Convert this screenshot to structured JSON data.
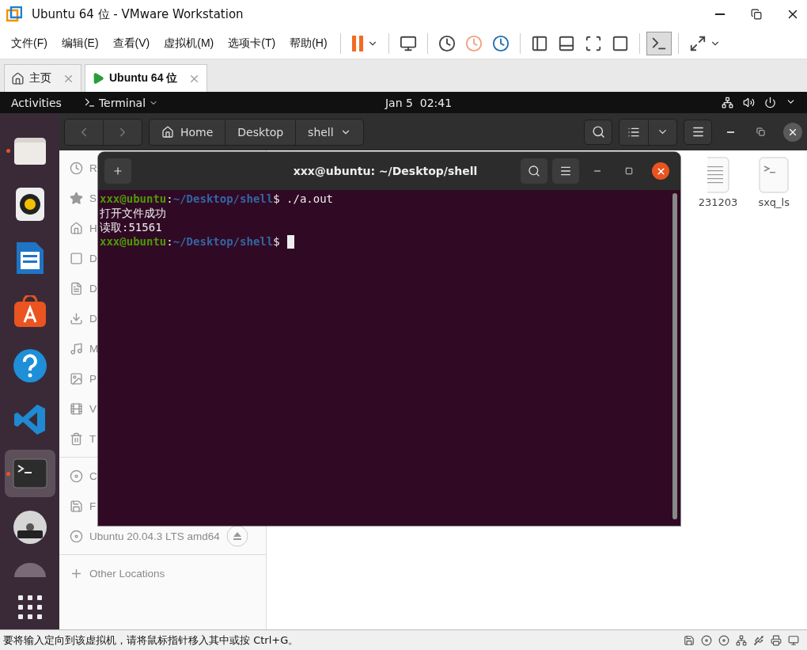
{
  "window": {
    "title": "Ubuntu 64 位 - VMware Workstation"
  },
  "menu": [
    {
      "label": "文件(F)"
    },
    {
      "label": "编辑(E)"
    },
    {
      "label": "查看(V)"
    },
    {
      "label": "虚拟机(M)"
    },
    {
      "label": "选项卡(T)"
    },
    {
      "label": "帮助(H)"
    }
  ],
  "toolbar": [
    {
      "kind": "pause",
      "selected": false
    },
    {
      "kind": "send-keys",
      "selected": false
    },
    {
      "kind": "snapshot",
      "selected": false
    },
    {
      "kind": "revert",
      "selected": false
    },
    {
      "kind": "snapshot-manager",
      "selected": false
    },
    {
      "kind": "library",
      "selected": false
    },
    {
      "kind": "thumbnail",
      "selected": false
    },
    {
      "kind": "full-screen",
      "selected": false
    },
    {
      "kind": "unity",
      "selected": false
    },
    {
      "kind": "console",
      "selected": true
    },
    {
      "kind": "stretch",
      "selected": false
    }
  ],
  "tabs": [
    {
      "label": "主页",
      "kind": "home",
      "selected": false
    },
    {
      "label": "Ubuntu 64 位",
      "kind": "vm",
      "selected": true
    }
  ],
  "top_bar": {
    "activities": "Activities",
    "app_menu": "Terminal",
    "clock": "Jan 5  02:41"
  },
  "dock": [
    {
      "kind": "files",
      "running": true,
      "selected": false
    },
    {
      "kind": "music",
      "running": false,
      "selected": false
    },
    {
      "kind": "writer",
      "running": false,
      "selected": false
    },
    {
      "kind": "software",
      "running": false,
      "selected": false
    },
    {
      "kind": "help",
      "running": false,
      "selected": false
    },
    {
      "kind": "vscode",
      "running": false,
      "selected": false
    },
    {
      "kind": "terminal",
      "running": true,
      "selected": true
    },
    {
      "kind": "dvd",
      "running": false,
      "selected": false
    },
    {
      "kind": "disk",
      "running": false,
      "selected": false
    },
    {
      "kind": "apps",
      "running": false,
      "selected": false
    }
  ],
  "file_manager": {
    "path": [
      "Home",
      "Desktop",
      "shell"
    ],
    "sidebar": [
      {
        "kind": "recent",
        "label": "R"
      },
      {
        "kind": "starred",
        "label": "S"
      },
      {
        "kind": "home",
        "label": "H"
      },
      {
        "kind": "desktop",
        "label": "D"
      },
      {
        "kind": "documents",
        "label": "D"
      },
      {
        "kind": "downloads",
        "label": "D"
      },
      {
        "kind": "music",
        "label": "M"
      },
      {
        "kind": "pictures",
        "label": "P"
      },
      {
        "kind": "videos",
        "label": "V"
      },
      {
        "kind": "trash",
        "label": "T"
      },
      {
        "kind": "divider"
      },
      {
        "kind": "disc",
        "label": "C"
      },
      {
        "kind": "floppy",
        "label": "F"
      },
      {
        "kind": "disc",
        "label": "Ubuntu 20.04.3 LTS amd64",
        "eject": true
      },
      {
        "kind": "divider"
      },
      {
        "kind": "other",
        "label": "Other Locations"
      }
    ],
    "files": [
      {
        "kind": "text",
        "name": "231203"
      },
      {
        "kind": "script",
        "name": "sxq_ls"
      }
    ]
  },
  "terminal": {
    "title": "xxx@ubuntu: ~/Desktop/shell",
    "lines": [
      {
        "kind": "prompt",
        "user": "xxx@ubuntu",
        "colon": ":",
        "path": "~/Desktop/shell",
        "dollar": "$",
        "command": "./a.out"
      },
      {
        "kind": "output",
        "text": "打开文件成功"
      },
      {
        "kind": "output",
        "text": "读取:51561"
      },
      {
        "kind": "prompt",
        "user": "xxx@ubuntu",
        "colon": ":",
        "path": "~/Desktop/shell",
        "dollar": "$",
        "cursor": true
      }
    ]
  },
  "status_bar": {
    "text": "要将输入定向到该虚拟机，请将鼠标指针移入其中或按 Ctrl+G。"
  }
}
